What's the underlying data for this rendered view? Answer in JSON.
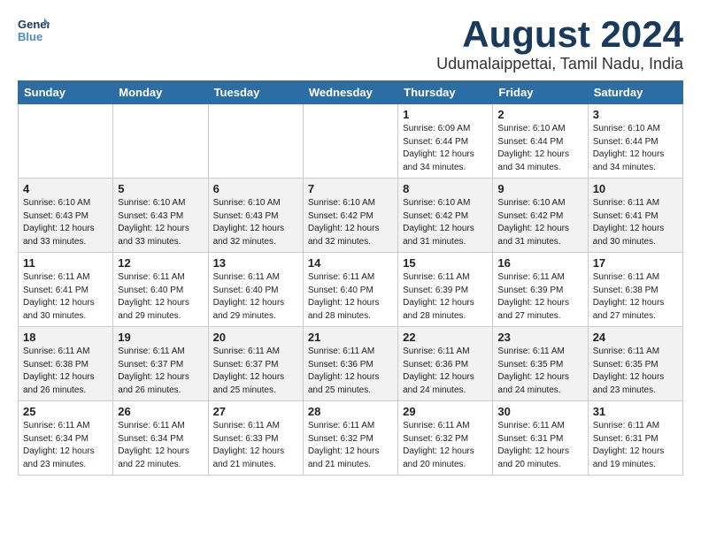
{
  "header": {
    "logo_general": "General",
    "logo_blue": "Blue",
    "month_title": "August 2024",
    "subtitle": "Udumalaippettai, Tamil Nadu, India"
  },
  "weekdays": [
    "Sunday",
    "Monday",
    "Tuesday",
    "Wednesday",
    "Thursday",
    "Friday",
    "Saturday"
  ],
  "weeks": [
    [
      {
        "day": "",
        "info": ""
      },
      {
        "day": "",
        "info": ""
      },
      {
        "day": "",
        "info": ""
      },
      {
        "day": "",
        "info": ""
      },
      {
        "day": "1",
        "info": "Sunrise: 6:09 AM\nSunset: 6:44 PM\nDaylight: 12 hours\nand 34 minutes."
      },
      {
        "day": "2",
        "info": "Sunrise: 6:10 AM\nSunset: 6:44 PM\nDaylight: 12 hours\nand 34 minutes."
      },
      {
        "day": "3",
        "info": "Sunrise: 6:10 AM\nSunset: 6:44 PM\nDaylight: 12 hours\nand 34 minutes."
      }
    ],
    [
      {
        "day": "4",
        "info": "Sunrise: 6:10 AM\nSunset: 6:43 PM\nDaylight: 12 hours\nand 33 minutes."
      },
      {
        "day": "5",
        "info": "Sunrise: 6:10 AM\nSunset: 6:43 PM\nDaylight: 12 hours\nand 33 minutes."
      },
      {
        "day": "6",
        "info": "Sunrise: 6:10 AM\nSunset: 6:43 PM\nDaylight: 12 hours\nand 32 minutes."
      },
      {
        "day": "7",
        "info": "Sunrise: 6:10 AM\nSunset: 6:42 PM\nDaylight: 12 hours\nand 32 minutes."
      },
      {
        "day": "8",
        "info": "Sunrise: 6:10 AM\nSunset: 6:42 PM\nDaylight: 12 hours\nand 31 minutes."
      },
      {
        "day": "9",
        "info": "Sunrise: 6:10 AM\nSunset: 6:42 PM\nDaylight: 12 hours\nand 31 minutes."
      },
      {
        "day": "10",
        "info": "Sunrise: 6:11 AM\nSunset: 6:41 PM\nDaylight: 12 hours\nand 30 minutes."
      }
    ],
    [
      {
        "day": "11",
        "info": "Sunrise: 6:11 AM\nSunset: 6:41 PM\nDaylight: 12 hours\nand 30 minutes."
      },
      {
        "day": "12",
        "info": "Sunrise: 6:11 AM\nSunset: 6:40 PM\nDaylight: 12 hours\nand 29 minutes."
      },
      {
        "day": "13",
        "info": "Sunrise: 6:11 AM\nSunset: 6:40 PM\nDaylight: 12 hours\nand 29 minutes."
      },
      {
        "day": "14",
        "info": "Sunrise: 6:11 AM\nSunset: 6:40 PM\nDaylight: 12 hours\nand 28 minutes."
      },
      {
        "day": "15",
        "info": "Sunrise: 6:11 AM\nSunset: 6:39 PM\nDaylight: 12 hours\nand 28 minutes."
      },
      {
        "day": "16",
        "info": "Sunrise: 6:11 AM\nSunset: 6:39 PM\nDaylight: 12 hours\nand 27 minutes."
      },
      {
        "day": "17",
        "info": "Sunrise: 6:11 AM\nSunset: 6:38 PM\nDaylight: 12 hours\nand 27 minutes."
      }
    ],
    [
      {
        "day": "18",
        "info": "Sunrise: 6:11 AM\nSunset: 6:38 PM\nDaylight: 12 hours\nand 26 minutes."
      },
      {
        "day": "19",
        "info": "Sunrise: 6:11 AM\nSunset: 6:37 PM\nDaylight: 12 hours\nand 26 minutes."
      },
      {
        "day": "20",
        "info": "Sunrise: 6:11 AM\nSunset: 6:37 PM\nDaylight: 12 hours\nand 25 minutes."
      },
      {
        "day": "21",
        "info": "Sunrise: 6:11 AM\nSunset: 6:36 PM\nDaylight: 12 hours\nand 25 minutes."
      },
      {
        "day": "22",
        "info": "Sunrise: 6:11 AM\nSunset: 6:36 PM\nDaylight: 12 hours\nand 24 minutes."
      },
      {
        "day": "23",
        "info": "Sunrise: 6:11 AM\nSunset: 6:35 PM\nDaylight: 12 hours\nand 24 minutes."
      },
      {
        "day": "24",
        "info": "Sunrise: 6:11 AM\nSunset: 6:35 PM\nDaylight: 12 hours\nand 23 minutes."
      }
    ],
    [
      {
        "day": "25",
        "info": "Sunrise: 6:11 AM\nSunset: 6:34 PM\nDaylight: 12 hours\nand 23 minutes."
      },
      {
        "day": "26",
        "info": "Sunrise: 6:11 AM\nSunset: 6:34 PM\nDaylight: 12 hours\nand 22 minutes."
      },
      {
        "day": "27",
        "info": "Sunrise: 6:11 AM\nSunset: 6:33 PM\nDaylight: 12 hours\nand 21 minutes."
      },
      {
        "day": "28",
        "info": "Sunrise: 6:11 AM\nSunset: 6:32 PM\nDaylight: 12 hours\nand 21 minutes."
      },
      {
        "day": "29",
        "info": "Sunrise: 6:11 AM\nSunset: 6:32 PM\nDaylight: 12 hours\nand 20 minutes."
      },
      {
        "day": "30",
        "info": "Sunrise: 6:11 AM\nSunset: 6:31 PM\nDaylight: 12 hours\nand 20 minutes."
      },
      {
        "day": "31",
        "info": "Sunrise: 6:11 AM\nSunset: 6:31 PM\nDaylight: 12 hours\nand 19 minutes."
      }
    ]
  ]
}
